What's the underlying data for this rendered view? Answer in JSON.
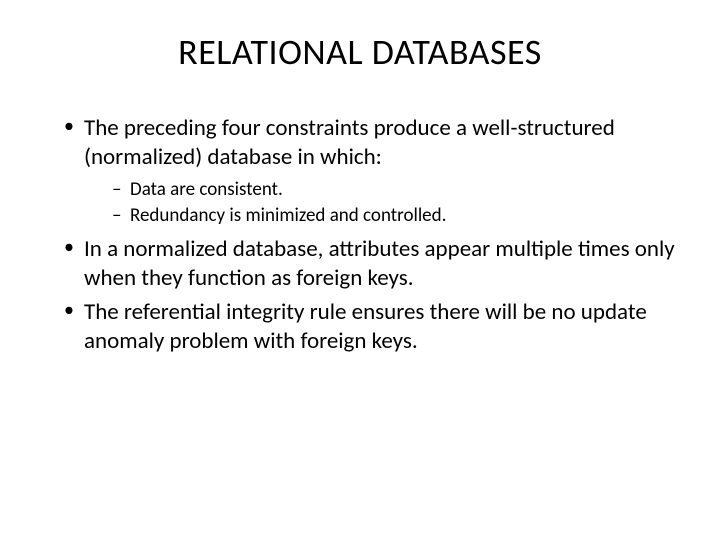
{
  "title": "RELATIONAL DATABASES",
  "bullets": {
    "b1": "The preceding four constraints produce a well-structured (normalized) database in which:",
    "b1_sub1": "Data are consistent.",
    "b1_sub2": "Redundancy is minimized and controlled.",
    "b2": "In a normalized database, attributes appear multiple times only when they function as foreign keys.",
    "b3": "The referential integrity rule ensures there will be no update anomaly problem with foreign keys."
  }
}
